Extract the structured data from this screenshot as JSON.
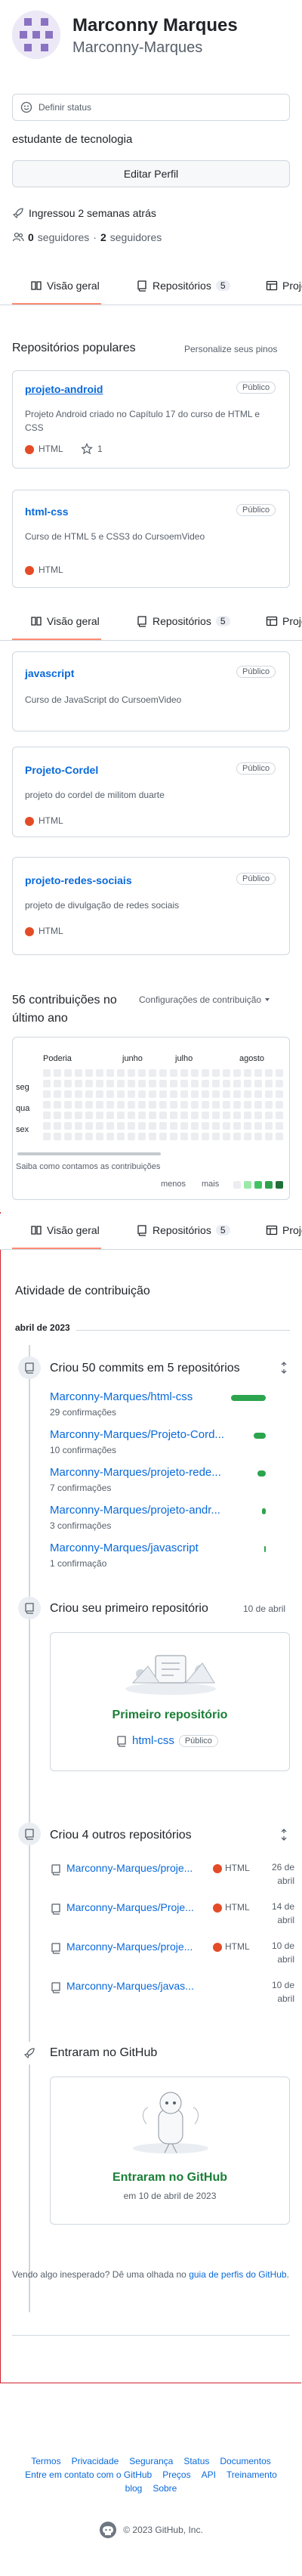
{
  "profile": {
    "name": "Marconny Marques",
    "username": "Marconny-Marques",
    "status_placeholder": "Definir status",
    "bio": "estudante de tecnologia",
    "edit_label": "Editar Perfil",
    "joined": "Ingressou 2 semanas atrás",
    "followers_count": "0",
    "followers_label": "seguidores",
    "following_count": "2",
    "following_label": "seguidores",
    "sep": "·"
  },
  "tabs": {
    "overview": "Visão geral",
    "repos": "Repositórios",
    "repos_count": "5",
    "projects": "Projetos"
  },
  "popular": {
    "title": "Repositórios populares",
    "customize": "Personalize seus pinos",
    "public": "Público",
    "repos": [
      {
        "name": "projeto-android",
        "desc": "Projeto Android criado no Capítulo 17 do curso de HTML e CSS",
        "lang": "HTML",
        "stars": "1"
      },
      {
        "name": "html-css",
        "desc": "Curso de HTML 5 e CSS3 do CursoemVideo",
        "lang": "HTML"
      },
      {
        "name": "javascript",
        "desc": "Curso de JavaScript do CursoemVideo"
      },
      {
        "name": "Projeto-Cordel",
        "desc": "projeto do cordel de militom duarte",
        "lang": "HTML"
      },
      {
        "name": "projeto-redes-sociais",
        "desc": "projeto de divulgação de redes sociais",
        "lang": "HTML"
      }
    ]
  },
  "contrib": {
    "title": "56 contribuições no último ano",
    "settings": "Configurações de contribuição",
    "months": [
      "Poderia",
      "junho",
      "julho",
      "agosto"
    ],
    "days": [
      "seg",
      "qua",
      "sex"
    ],
    "learn": "Saiba como contamos as contribuições",
    "less": "menos",
    "more": "mais"
  },
  "activity": {
    "title": "Atividade de contribuição",
    "month": "abril de 2023",
    "commits_title": "Criou 50 commits em 5 repositórios",
    "commit_repos": [
      {
        "name": "Marconny-Marques/html-css",
        "count": "29 confirmações",
        "pct": 0.58
      },
      {
        "name": "Marconny-Marques/Projeto-Cord...",
        "count": "10 confirmações",
        "pct": 0.2
      },
      {
        "name": "Marconny-Marques/projeto-rede...",
        "count": "7 confirmações",
        "pct": 0.14
      },
      {
        "name": "Marconny-Marques/projeto-andr...",
        "count": "3 confirmações",
        "pct": 0.06
      },
      {
        "name": "Marconny-Marques/javascript",
        "count": "1 confirmação",
        "pct": 0.02
      }
    ],
    "first_repo_title": "Criou seu primeiro repositório",
    "first_repo_date": "10 de abril",
    "first_repo_card": "Primeiro repositório",
    "first_repo_name": "html-css",
    "public": "Público",
    "other_title": "Criou 4 outros repositórios",
    "other_repos": [
      {
        "name": "Marconny-Marques/proje...",
        "lang": "HTML",
        "date1": "26 de",
        "date2": "abril"
      },
      {
        "name": "Marconny-Marques/Proje...",
        "lang": "HTML",
        "date1": "14 de",
        "date2": "abril"
      },
      {
        "name": "Marconny-Marques/proje...",
        "lang": "HTML",
        "date1": "10 de",
        "date2": "abril"
      },
      {
        "name": "Marconny-Marques/javas...",
        "lang": "",
        "date1": "10 de",
        "date2": "abril"
      }
    ],
    "joined_title": "Entraram no GitHub",
    "joined_card": "Entrarам no GitHub",
    "joined_date": "em 10 de abril de 2023",
    "unexpected_a": "Vendo algo inesperado? Dê uma olhada no ",
    "unexpected_link": "guia de perfis do GitHub",
    "unexpected_b": "."
  },
  "footer": {
    "links": [
      "Termos",
      "Privacidade",
      "Segurança",
      "Status",
      "Documentos",
      "Entre em contato com o GitHub",
      "Preços",
      "API",
      "Treinamento",
      "blog",
      "Sobre"
    ],
    "copyright": "© 2023 GitHub, Inc."
  },
  "colors": {
    "accent": "#0969da",
    "html": "#e34c26",
    "green": "#1a7f37",
    "border": "#d0d7de",
    "red_border": "#cf222e"
  }
}
